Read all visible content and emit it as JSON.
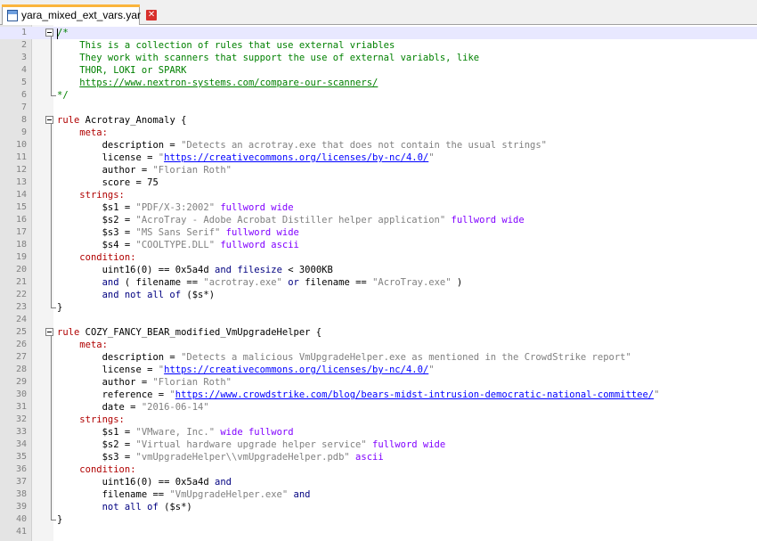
{
  "tab": {
    "filename": "yara_mixed_ext_vars.yar",
    "close_glyph": "✕"
  },
  "editor": {
    "lines": [
      {
        "n": "1",
        "parts": [
          [
            "comment",
            "/*"
          ]
        ]
      },
      {
        "n": "2",
        "parts": [
          [
            "comment",
            "    This is a collection of rules that use external vriables"
          ]
        ]
      },
      {
        "n": "3",
        "parts": [
          [
            "comment",
            "    They work with scanners that support the use of external variabls, like"
          ]
        ]
      },
      {
        "n": "4",
        "parts": [
          [
            "comment",
            "    THOR, LOKI or SPARK"
          ]
        ]
      },
      {
        "n": "5",
        "parts": [
          [
            "comment",
            "    "
          ],
          [
            "url",
            "https://www.nextron-systems.com/compare-our-scanners/"
          ]
        ]
      },
      {
        "n": "6",
        "parts": [
          [
            "comment",
            "*/"
          ]
        ]
      },
      {
        "n": "7",
        "parts": []
      },
      {
        "n": "8",
        "parts": [
          [
            "rule",
            "rule"
          ],
          [
            "plain",
            " Acrotray_Anomaly {"
          ]
        ]
      },
      {
        "n": "9",
        "parts": [
          [
            "plain",
            "    "
          ],
          [
            "sect",
            "meta:"
          ]
        ]
      },
      {
        "n": "10",
        "parts": [
          [
            "plain",
            "        description = "
          ],
          [
            "str",
            "\"Detects an acrotray.exe that does not contain the usual strings\""
          ]
        ]
      },
      {
        "n": "11",
        "parts": [
          [
            "plain",
            "        license = "
          ],
          [
            "str",
            "\""
          ],
          [
            "lurl",
            "https://creativecommons.org/licenses/by-nc/4.0/"
          ],
          [
            "str",
            "\""
          ]
        ]
      },
      {
        "n": "12",
        "parts": [
          [
            "plain",
            "        author = "
          ],
          [
            "str",
            "\"Florian Roth\""
          ]
        ]
      },
      {
        "n": "13",
        "parts": [
          [
            "plain",
            "        score = 75"
          ]
        ]
      },
      {
        "n": "14",
        "parts": [
          [
            "plain",
            "    "
          ],
          [
            "sect",
            "strings:"
          ]
        ]
      },
      {
        "n": "15",
        "parts": [
          [
            "plain",
            "        $s1 = "
          ],
          [
            "str",
            "\"PDF/X-3:2002\""
          ],
          [
            "kw",
            " fullword wide"
          ]
        ]
      },
      {
        "n": "16",
        "parts": [
          [
            "plain",
            "        $s2 = "
          ],
          [
            "str",
            "\"AcroTray - Adobe Acrobat Distiller helper application\""
          ],
          [
            "kw",
            " fullword wide"
          ]
        ]
      },
      {
        "n": "17",
        "parts": [
          [
            "plain",
            "        $s3 = "
          ],
          [
            "str",
            "\"MS Sans Serif\""
          ],
          [
            "kw",
            " fullword wide"
          ]
        ]
      },
      {
        "n": "18",
        "parts": [
          [
            "plain",
            "        $s4 = "
          ],
          [
            "str",
            "\"COOLTYPE.DLL\""
          ],
          [
            "kw",
            " fullword ascii"
          ]
        ]
      },
      {
        "n": "19",
        "parts": [
          [
            "plain",
            "    "
          ],
          [
            "sect",
            "condition:"
          ]
        ]
      },
      {
        "n": "20",
        "parts": [
          [
            "plain",
            "        uint16(0) == 0x5a4d "
          ],
          [
            "k",
            "and"
          ],
          [
            "plain",
            " "
          ],
          [
            "k",
            "filesize"
          ],
          [
            "plain",
            " < 3000KB"
          ]
        ]
      },
      {
        "n": "21",
        "parts": [
          [
            "plain",
            "        "
          ],
          [
            "k",
            "and"
          ],
          [
            "plain",
            " ( filename == "
          ],
          [
            "str",
            "\"acrotray.exe\""
          ],
          [
            "plain",
            " "
          ],
          [
            "k",
            "or"
          ],
          [
            "plain",
            " filename == "
          ],
          [
            "str",
            "\"AcroTray.exe\""
          ],
          [
            "plain",
            " )"
          ]
        ]
      },
      {
        "n": "22",
        "parts": [
          [
            "plain",
            "        "
          ],
          [
            "k",
            "and not all of"
          ],
          [
            "plain",
            " ($s*)"
          ]
        ]
      },
      {
        "n": "23",
        "parts": [
          [
            "plain",
            "}"
          ]
        ]
      },
      {
        "n": "24",
        "parts": []
      },
      {
        "n": "25",
        "parts": [
          [
            "rule",
            "rule"
          ],
          [
            "plain",
            " COZY_FANCY_BEAR_modified_VmUpgradeHelper {"
          ]
        ]
      },
      {
        "n": "26",
        "parts": [
          [
            "plain",
            "    "
          ],
          [
            "sect",
            "meta:"
          ]
        ]
      },
      {
        "n": "27",
        "parts": [
          [
            "plain",
            "        description = "
          ],
          [
            "str",
            "\"Detects a malicious VmUpgradeHelper.exe as mentioned in the CrowdStrike report\""
          ]
        ]
      },
      {
        "n": "28",
        "parts": [
          [
            "plain",
            "        license = "
          ],
          [
            "str",
            "\""
          ],
          [
            "lurl",
            "https://creativecommons.org/licenses/by-nc/4.0/"
          ],
          [
            "str",
            "\""
          ]
        ]
      },
      {
        "n": "29",
        "parts": [
          [
            "plain",
            "        author = "
          ],
          [
            "str",
            "\"Florian Roth\""
          ]
        ]
      },
      {
        "n": "30",
        "parts": [
          [
            "plain",
            "        reference = "
          ],
          [
            "str",
            "\""
          ],
          [
            "lurl",
            "https://www.crowdstrike.com/blog/bears-midst-intrusion-democratic-national-committee/"
          ],
          [
            "str",
            "\""
          ]
        ]
      },
      {
        "n": "31",
        "parts": [
          [
            "plain",
            "        date = "
          ],
          [
            "str",
            "\"2016-06-14\""
          ]
        ]
      },
      {
        "n": "32",
        "parts": [
          [
            "plain",
            "    "
          ],
          [
            "sect",
            "strings:"
          ]
        ]
      },
      {
        "n": "33",
        "parts": [
          [
            "plain",
            "        $s1 = "
          ],
          [
            "str",
            "\"VMware, Inc.\""
          ],
          [
            "kw",
            " wide fullword"
          ]
        ]
      },
      {
        "n": "34",
        "parts": [
          [
            "plain",
            "        $s2 = "
          ],
          [
            "str",
            "\"Virtual hardware upgrade helper service\""
          ],
          [
            "kw",
            " fullword wide"
          ]
        ]
      },
      {
        "n": "35",
        "parts": [
          [
            "plain",
            "        $s3 = "
          ],
          [
            "str",
            "\"vmUpgradeHelper\\\\vmUpgradeHelper.pdb\""
          ],
          [
            "kw",
            " ascii"
          ]
        ]
      },
      {
        "n": "36",
        "parts": [
          [
            "plain",
            "    "
          ],
          [
            "sect",
            "condition:"
          ]
        ]
      },
      {
        "n": "37",
        "parts": [
          [
            "plain",
            "        uint16(0) == 0x5a4d "
          ],
          [
            "k",
            "and"
          ]
        ]
      },
      {
        "n": "38",
        "parts": [
          [
            "plain",
            "        filename == "
          ],
          [
            "str",
            "\"VmUpgradeHelper.exe\""
          ],
          [
            "plain",
            " "
          ],
          [
            "k",
            "and"
          ]
        ]
      },
      {
        "n": "39",
        "parts": [
          [
            "plain",
            "        "
          ],
          [
            "k",
            "not all of"
          ],
          [
            "plain",
            " ($s*)"
          ]
        ]
      },
      {
        "n": "40",
        "parts": [
          [
            "plain",
            "}"
          ]
        ]
      },
      {
        "n": "41",
        "parts": []
      }
    ]
  },
  "colors": {
    "tab_accent": "#fab43c",
    "current_line": "#e8e8ff",
    "comment": "#008000",
    "string": "#808080",
    "keyword": "#000080",
    "rule": "#b00000",
    "modifier": "#8000ff"
  }
}
